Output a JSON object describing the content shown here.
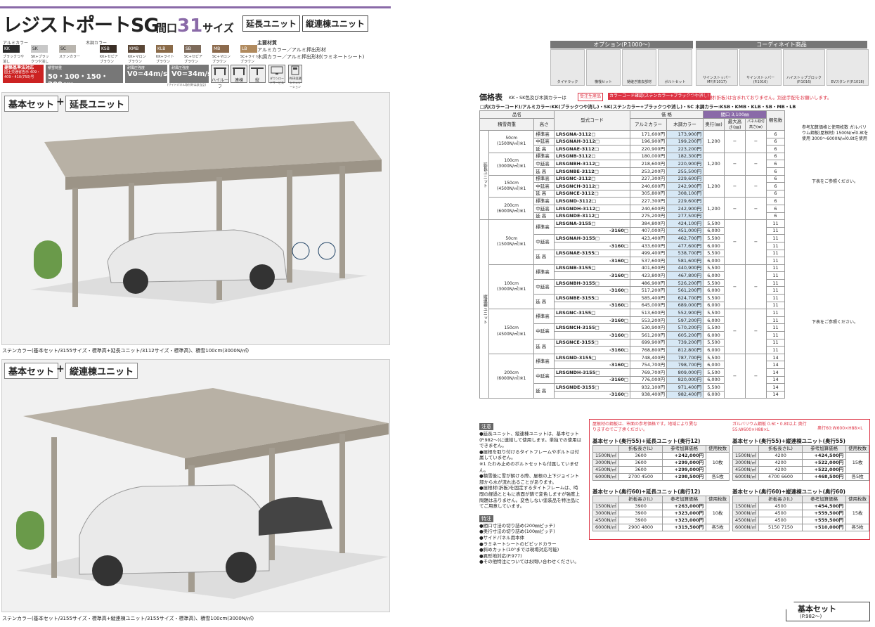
{
  "header": {
    "title": "レジストポートSG",
    "maguchi_pre": "間口",
    "maguchi_num": "31",
    "maguchi_post": "サイズ",
    "tag1": "延長ユニット",
    "tag2": "縦連棟ユニット"
  },
  "colors": {
    "alu_label": "アルミカラー",
    "wood_label": "木調カラー",
    "swatches": [
      {
        "code": "KK",
        "name": "ブラックつや消し",
        "hex": "#2b2b2b"
      },
      {
        "code": "SK",
        "name": "SK+ブラックつや消し",
        "hex": "#c8c8c8"
      },
      {
        "code": "SC",
        "name": "ステンカラー",
        "hex": "#b9b5ae"
      },
      {
        "code": "KSB",
        "name": "KK+セピアブラウン",
        "hex": "#3a2e26"
      },
      {
        "code": "KMB",
        "name": "KK+マロンブラウン",
        "hex": "#5a4636"
      },
      {
        "code": "KLB",
        "name": "KK+ライトブラウン",
        "hex": "#8a6a48"
      },
      {
        "code": "SB",
        "name": "SC+セピアブラウン",
        "hex": "#7d6a5a"
      },
      {
        "code": "MB",
        "name": "SC+マロンブラウン",
        "hex": "#8c6a4c"
      },
      {
        "code": "LB",
        "name": "SC+ライトブラウン",
        "hex": "#b08a5e"
      }
    ],
    "material_title": "主要材質",
    "material1": "アルミカラー／アルミ押出形材",
    "material2": "木調カラー／アルミ押出形材(ラミネートシート)"
  },
  "icons": {
    "badge": "建築基準法対応",
    "badge_sub": "国土交通省告示 409・409・410(750)号",
    "snow_label": "積雪荷重",
    "snow": "50・100・150・200cm",
    "wind1_label": "耐風圧強度",
    "wind1": "V0=44m/s",
    "wind2_label": "耐風圧強度",
    "wind2": "V0=34m/s",
    "wind2_note": "(サイドパネル取付時は該当品)",
    "i1": "ハイルーフ",
    "i2": "連棟",
    "i3": "縦",
    "i4": "ダウンロードサービス",
    "i5": "WEB見積シミュレーション"
  },
  "sections": {
    "s1_a": "基本セット",
    "s1_plus": "+",
    "s1_b": "延長ユニット",
    "s1_caption": "ステンカラー(基本セット/3155サイズ・標準高+延長ユニット/3112サイズ・標準高)、積雪100cm(3000N/㎡)",
    "s2_a": "基本セット",
    "s2_plus": "+",
    "s2_b": "縦連棟ユニット",
    "s2_caption": "ステンカラー(基本セット/3155サイズ・標準高+縦連棟ユニット/3155サイズ・標準高)、積雪100cm(3000N/㎡)"
  },
  "options": {
    "option_head": "オプション(P.1000〜)",
    "coord_head": "コーディネイト商品",
    "items": [
      "タイヤラック",
      "横桟セット",
      "樋継ぎ撤去部材",
      "ボルトセット",
      "サインストッパーMY(P.1017)",
      "サインストッパー(P.1016)",
      "ハイストップブロック(P.1016)",
      "EVスタンド(P.1018)"
    ]
  },
  "price": {
    "title": "価格表",
    "kk_note": "KK・SK色及び木調カラーは",
    "juchu": "受注生産品",
    "special": "カラーコード確認(ステンカラー+ブラックつや消し)",
    "red_note": "価格に屋根材(折板)は含まれておりません。別途手配をお願いします。",
    "code_note": "□内(カラーコード)/アルミカラー:KK(ブラックつや消し)・SK(ステンカラー+ブラックつや消し)・SC 木調カラー:KSB・KMB・KLB・SB・MB・LB",
    "h_hinmei": "品名",
    "h_katashiki": "型式コード",
    "h_kakaku": "価 格",
    "h_alu": "アルミカラー",
    "h_wood": "木調カラー",
    "h_maguchi": "間口 3,100㎜",
    "h_sekisetsu": "積雪荷重",
    "h_takasa": "高さ",
    "h_okuyuki": "奥行(㎜)",
    "h_maxh": "最大高さ(㎜)",
    "h_panel": "パネル取付高さ(㎜)",
    "h_maisu": "梱包数",
    "side_note": "参考加算価格と使用枚数 ガルバリウム鋼板(屋根材) 1500N/㎡0.8tを使用 3000〜6000N/㎡0.8tを使用",
    "see_below1": "下表をご参照ください。",
    "see_below2": "下表をご参照ください。",
    "unit_enchou": "延長ユニット",
    "unit_tate": "縦連棟ユニット",
    "enchou": [
      {
        "snow": "50cm",
        "load": "(1500N/㎡)※1",
        "rows": [
          [
            "標準高",
            "LRSGNA-3112□",
            "171,600円",
            "173,900円"
          ],
          [
            "中延高",
            "LRSGNAH-3112□",
            "196,900円",
            "199,200円"
          ],
          [
            "延 高",
            "LRSGNAE-3112□",
            "220,900円",
            "223,200円"
          ]
        ],
        "depth": "1,200",
        "max": "−",
        "panel": "−",
        "pack": [
          "6",
          "6",
          "6"
        ]
      },
      {
        "snow": "100cm",
        "load": "(3000N/㎡)※1",
        "rows": [
          [
            "標準高",
            "LRSGNB-3112□",
            "180,000円",
            "182,300円"
          ],
          [
            "中延高",
            "LRSGNBH-3112□",
            "218,600円",
            "220,900円"
          ],
          [
            "延 高",
            "LRSGNBE-3112□",
            "253,200円",
            "255,500円"
          ]
        ],
        "depth": "1,200",
        "max": "−",
        "panel": "−",
        "pack": [
          "6",
          "6",
          "6"
        ]
      },
      {
        "snow": "150cm",
        "load": "(4500N/㎡)※1",
        "rows": [
          [
            "標準高",
            "LRSGNC-3112□",
            "227,300円",
            "229,600円"
          ],
          [
            "中延高",
            "LRSGNCH-3112□",
            "240,600円",
            "242,900円"
          ],
          [
            "延 高",
            "LRSGNCE-3112□",
            "305,800円",
            "308,100円"
          ]
        ],
        "depth": "1,200",
        "max": "−",
        "panel": "−",
        "pack": [
          "6",
          "6",
          "6"
        ]
      },
      {
        "snow": "200cm",
        "load": "(6000N/㎡)※1",
        "rows": [
          [
            "標準高",
            "LRSGND-3112□",
            "227,300円",
            "229,600円"
          ],
          [
            "中延高",
            "LRSGNDH-3112□",
            "240,600円",
            "242,900円"
          ],
          [
            "延 高",
            "LRSGNDE-3112□",
            "275,200円",
            "277,500円"
          ]
        ],
        "depth": "1,200",
        "max": "−",
        "panel": "−",
        "pack": [
          "6",
          "6",
          "6"
        ]
      }
    ],
    "tate": [
      {
        "snow": "50cm",
        "load": "(1500N/㎡)※1",
        "rows": [
          [
            "標準高",
            "LRSGNA-3155□",
            "384,800円",
            "424,100円",
            "5,500",
            "11"
          ],
          [
            "",
            "-3160□",
            "407,000円",
            "451,000円",
            "6,000",
            "11"
          ],
          [
            "中延高",
            "LRSGNAH-3155□",
            "423,400円",
            "462,700円",
            "5,500",
            "11"
          ],
          [
            "",
            "-3160□",
            "433,600円",
            "477,600円",
            "6,000",
            "11"
          ],
          [
            "延 高",
            "LRSGNAE-3155□",
            "499,400円",
            "538,700円",
            "5,500",
            "11"
          ],
          [
            "",
            "-3160□",
            "537,600円",
            "581,600円",
            "6,000",
            "11"
          ]
        ]
      },
      {
        "snow": "100cm",
        "load": "(3000N/㎡)※1",
        "rows": [
          [
            "標準高",
            "LRSGNB-3155□",
            "401,600円",
            "440,900円",
            "5,500",
            "11"
          ],
          [
            "",
            "-3160□",
            "423,800円",
            "467,800円",
            "6,000",
            "11"
          ],
          [
            "中延高",
            "LRSGNBH-3155□",
            "486,900円",
            "526,200円",
            "5,500",
            "11"
          ],
          [
            "",
            "-3160□",
            "517,200円",
            "561,200円",
            "6,000",
            "11"
          ],
          [
            "延 高",
            "LRSGNBE-3155□",
            "585,400円",
            "624,700円",
            "5,500",
            "11"
          ],
          [
            "",
            "-3160□",
            "645,000円",
            "689,000円",
            "6,000",
            "11"
          ]
        ]
      },
      {
        "snow": "150cm",
        "load": "(4500N/㎡)※1",
        "rows": [
          [
            "標準高",
            "LRSGNC-3155□",
            "513,600円",
            "552,900円",
            "5,500",
            "11"
          ],
          [
            "",
            "-3160□",
            "553,200円",
            "597,200円",
            "6,000",
            "11"
          ],
          [
            "中延高",
            "LRSGNCH-3155□",
            "530,900円",
            "570,200円",
            "5,500",
            "11"
          ],
          [
            "",
            "-3160□",
            "561,200円",
            "605,200円",
            "6,000",
            "11"
          ],
          [
            "延 高",
            "LRSGNCE-3155□",
            "699,900円",
            "739,200円",
            "5,500",
            "11"
          ],
          [
            "",
            "-3160□",
            "768,800円",
            "812,800円",
            "6,000",
            "11"
          ]
        ]
      },
      {
        "snow": "200cm",
        "load": "(6000N/㎡)※1",
        "rows": [
          [
            "標準高",
            "LRSGND-3155□",
            "748,400円",
            "787,700円",
            "5,500",
            "14"
          ],
          [
            "",
            "-3160□",
            "754,700円",
            "798,700円",
            "6,000",
            "14"
          ],
          [
            "中延高",
            "LRSGNDH-3155□",
            "769,700円",
            "809,000円",
            "5,500",
            "14"
          ],
          [
            "",
            "-3160□",
            "776,000円",
            "820,000円",
            "6,000",
            "14"
          ],
          [
            "延 高",
            "LRSGNDE-3155□",
            "932,100円",
            "971,400円",
            "5,500",
            "14"
          ],
          [
            "",
            "-3160□",
            "938,400円",
            "982,400円",
            "6,000",
            "14"
          ]
        ]
      }
    ]
  },
  "notes": {
    "head": "注意",
    "items": [
      "●延長ユニット、縦連棟ユニットは、基本セット(P.982〜)に連結して使用します。単独での使用はできません。",
      "●屋根を取り付けるタイトフレームやボルトは付属していません。",
      "※1 たわみ止めのボルトセットも付属していません。",
      "●積雪後に雪が解ける際、屋根の上下ジョイント部から水が流れ出ることがあります。",
      "●屋根材(折板)を固定するタイトフレームは、時間の経過とともに表面が錆で変色しますが強度上問題はありません。変色しない塗装品を特注品にてご用意しています。"
    ],
    "head2": "特注",
    "items2": [
      "●間口寸法の切り詰め(200㎜ピッチ)",
      "●奥行寸法の切り詰め(100㎜ピッチ)",
      "●サイドパネル用本体",
      "●ラミネートシートのビビッドカラー",
      "●斜めカット(10°までは現場対応可能)",
      "●異形地対応(P.977)",
      "●その他特注についてはお問い合わせください。"
    ]
  },
  "subtables": {
    "red1": "屋根材の鋼板は、市面の参考価格です。地域により異なりますのでご了承ください。",
    "red2": "ガルバリウム鋼板 0.6t・0.8t以上 奥行55:W600×H88×L",
    "red3": "奥行60:W600×H88×L",
    "tables": [
      {
        "title": "基本セット(奥行55)+延長ユニット(奥行12)",
        "h": [
          "",
          "折板長さ(L)",
          "参考加算価格",
          "使用枚数"
        ],
        "rows": [
          [
            "1500N/㎡",
            "3600",
            "+242,000円"
          ],
          [
            "3000N/㎡",
            "3600",
            "+299,000円"
          ],
          [
            "4500N/㎡",
            "3600",
            "+299,000円"
          ],
          [
            "6000N/㎡",
            "2700 4500",
            "+298,500円"
          ]
        ],
        "count": "10枚",
        "count2": "各5枚"
      },
      {
        "title": "基本セット(奥行55)+縦連棟ユニット(奥行55)",
        "h": [
          "",
          "折板長さ(L)",
          "参考加算価格",
          "使用枚数"
        ],
        "rows": [
          [
            "1500N/㎡",
            "4200",
            "+424,500円"
          ],
          [
            "3000N/㎡",
            "4200",
            "+522,000円"
          ],
          [
            "4500N/㎡",
            "4200",
            "+522,000円"
          ],
          [
            "6000N/㎡",
            "4700 6600",
            "+468,500円"
          ]
        ],
        "count": "15枚",
        "count2": "各5枚"
      },
      {
        "title": "基本セット(奥行60)+延長ユニット(奥行12)",
        "h": [
          "",
          "折板長さ(L)",
          "参考加算価格",
          "使用枚数"
        ],
        "rows": [
          [
            "1500N/㎡",
            "3900",
            "+263,000円"
          ],
          [
            "3000N/㎡",
            "3900",
            "+323,000円"
          ],
          [
            "4500N/㎡",
            "3900",
            "+323,000円"
          ],
          [
            "6000N/㎡",
            "2900 4800",
            "+319,500円"
          ]
        ],
        "count": "10枚",
        "count2": "各5枚"
      },
      {
        "title": "基本セット(奥行60)+縦連棟ユニット(奥行60)",
        "h": [
          "",
          "折板長さ(L)",
          "参考加算価格",
          "使用枚数"
        ],
        "rows": [
          [
            "1500N/㎡",
            "4500",
            "+454,500円"
          ],
          [
            "3000N/㎡",
            "4500",
            "+559,500円"
          ],
          [
            "4500N/㎡",
            "4500",
            "+559,500円"
          ],
          [
            "6000N/㎡",
            "5150 7150",
            "+510,000円"
          ]
        ],
        "count": "15枚",
        "count2": "各5枚"
      }
    ]
  },
  "footer": {
    "link": "基本セット",
    "page": "(P.982〜)"
  }
}
